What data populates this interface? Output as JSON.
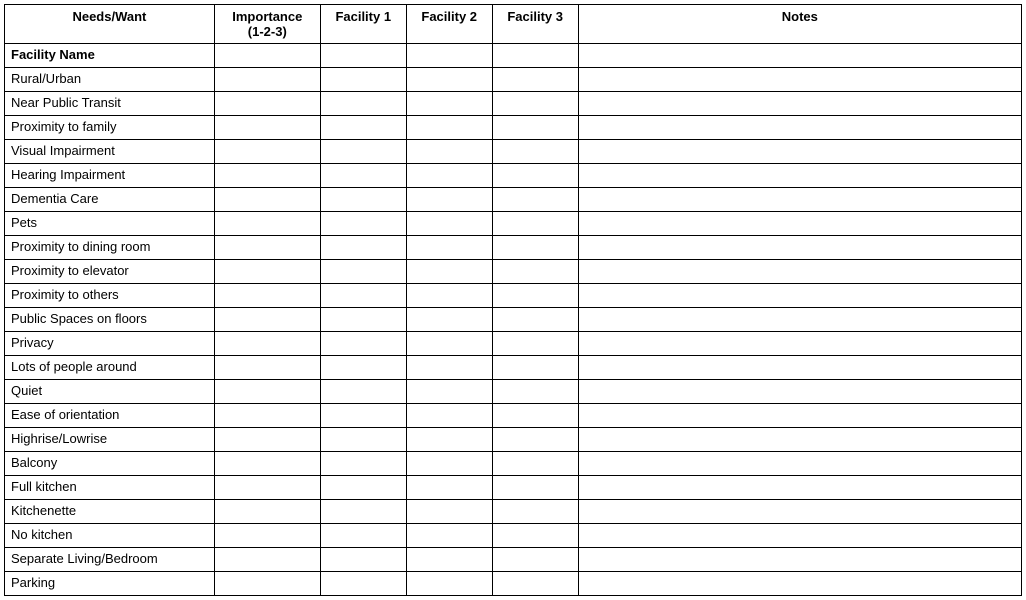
{
  "headers": {
    "needs": "Needs/Want",
    "importance_line1": "Importance",
    "importance_line2": "(1-2-3)",
    "facility1": "Facility  1",
    "facility2": "Facility 2",
    "facility3": "Facility 3",
    "notes": "Notes"
  },
  "rows": [
    {
      "label": "Facility Name",
      "bold": true,
      "importance": "",
      "f1": "",
      "f2": "",
      "f3": "",
      "notes": ""
    },
    {
      "label": "Rural/Urban",
      "bold": false,
      "importance": "",
      "f1": "",
      "f2": "",
      "f3": "",
      "notes": ""
    },
    {
      "label": "Near Public Transit",
      "bold": false,
      "importance": "",
      "f1": "",
      "f2": "",
      "f3": "",
      "notes": ""
    },
    {
      "label": "Proximity to family",
      "bold": false,
      "importance": "",
      "f1": "",
      "f2": "",
      "f3": "",
      "notes": ""
    },
    {
      "label": "Visual Impairment",
      "bold": false,
      "importance": "",
      "f1": "",
      "f2": "",
      "f3": "",
      "notes": ""
    },
    {
      "label": "Hearing Impairment",
      "bold": false,
      "importance": "",
      "f1": "",
      "f2": "",
      "f3": "",
      "notes": ""
    },
    {
      "label": "Dementia Care",
      "bold": false,
      "importance": "",
      "f1": "",
      "f2": "",
      "f3": "",
      "notes": ""
    },
    {
      "label": "Pets",
      "bold": false,
      "importance": "",
      "f1": "",
      "f2": "",
      "f3": "",
      "notes": ""
    },
    {
      "label": "Proximity to dining room",
      "bold": false,
      "importance": "",
      "f1": "",
      "f2": "",
      "f3": "",
      "notes": ""
    },
    {
      "label": "Proximity to elevator",
      "bold": false,
      "importance": "",
      "f1": "",
      "f2": "",
      "f3": "",
      "notes": ""
    },
    {
      "label": "Proximity to others",
      "bold": false,
      "importance": "",
      "f1": "",
      "f2": "",
      "f3": "",
      "notes": ""
    },
    {
      "label": "Public Spaces on floors",
      "bold": false,
      "importance": "",
      "f1": "",
      "f2": "",
      "f3": "",
      "notes": ""
    },
    {
      "label": "Privacy",
      "bold": false,
      "importance": "",
      "f1": "",
      "f2": "",
      "f3": "",
      "notes": ""
    },
    {
      "label": "Lots of people around",
      "bold": false,
      "importance": "",
      "f1": "",
      "f2": "",
      "f3": "",
      "notes": ""
    },
    {
      "label": "Quiet",
      "bold": false,
      "importance": "",
      "f1": "",
      "f2": "",
      "f3": "",
      "notes": ""
    },
    {
      "label": "Ease of orientation",
      "bold": false,
      "importance": "",
      "f1": "",
      "f2": "",
      "f3": "",
      "notes": ""
    },
    {
      "label": "Highrise/Lowrise",
      "bold": false,
      "importance": "",
      "f1": "",
      "f2": "",
      "f3": "",
      "notes": ""
    },
    {
      "label": "Balcony",
      "bold": false,
      "importance": "",
      "f1": "",
      "f2": "",
      "f3": "",
      "notes": ""
    },
    {
      "label": "Full kitchen",
      "bold": false,
      "importance": "",
      "f1": "",
      "f2": "",
      "f3": "",
      "notes": ""
    },
    {
      "label": "Kitchenette",
      "bold": false,
      "importance": "",
      "f1": "",
      "f2": "",
      "f3": "",
      "notes": ""
    },
    {
      "label": "No kitchen",
      "bold": false,
      "importance": "",
      "f1": "",
      "f2": "",
      "f3": "",
      "notes": ""
    },
    {
      "label": "Separate Living/Bedroom",
      "bold": false,
      "importance": "",
      "f1": "",
      "f2": "",
      "f3": "",
      "notes": ""
    },
    {
      "label": "Parking",
      "bold": false,
      "importance": "",
      "f1": "",
      "f2": "",
      "f3": "",
      "notes": ""
    }
  ]
}
